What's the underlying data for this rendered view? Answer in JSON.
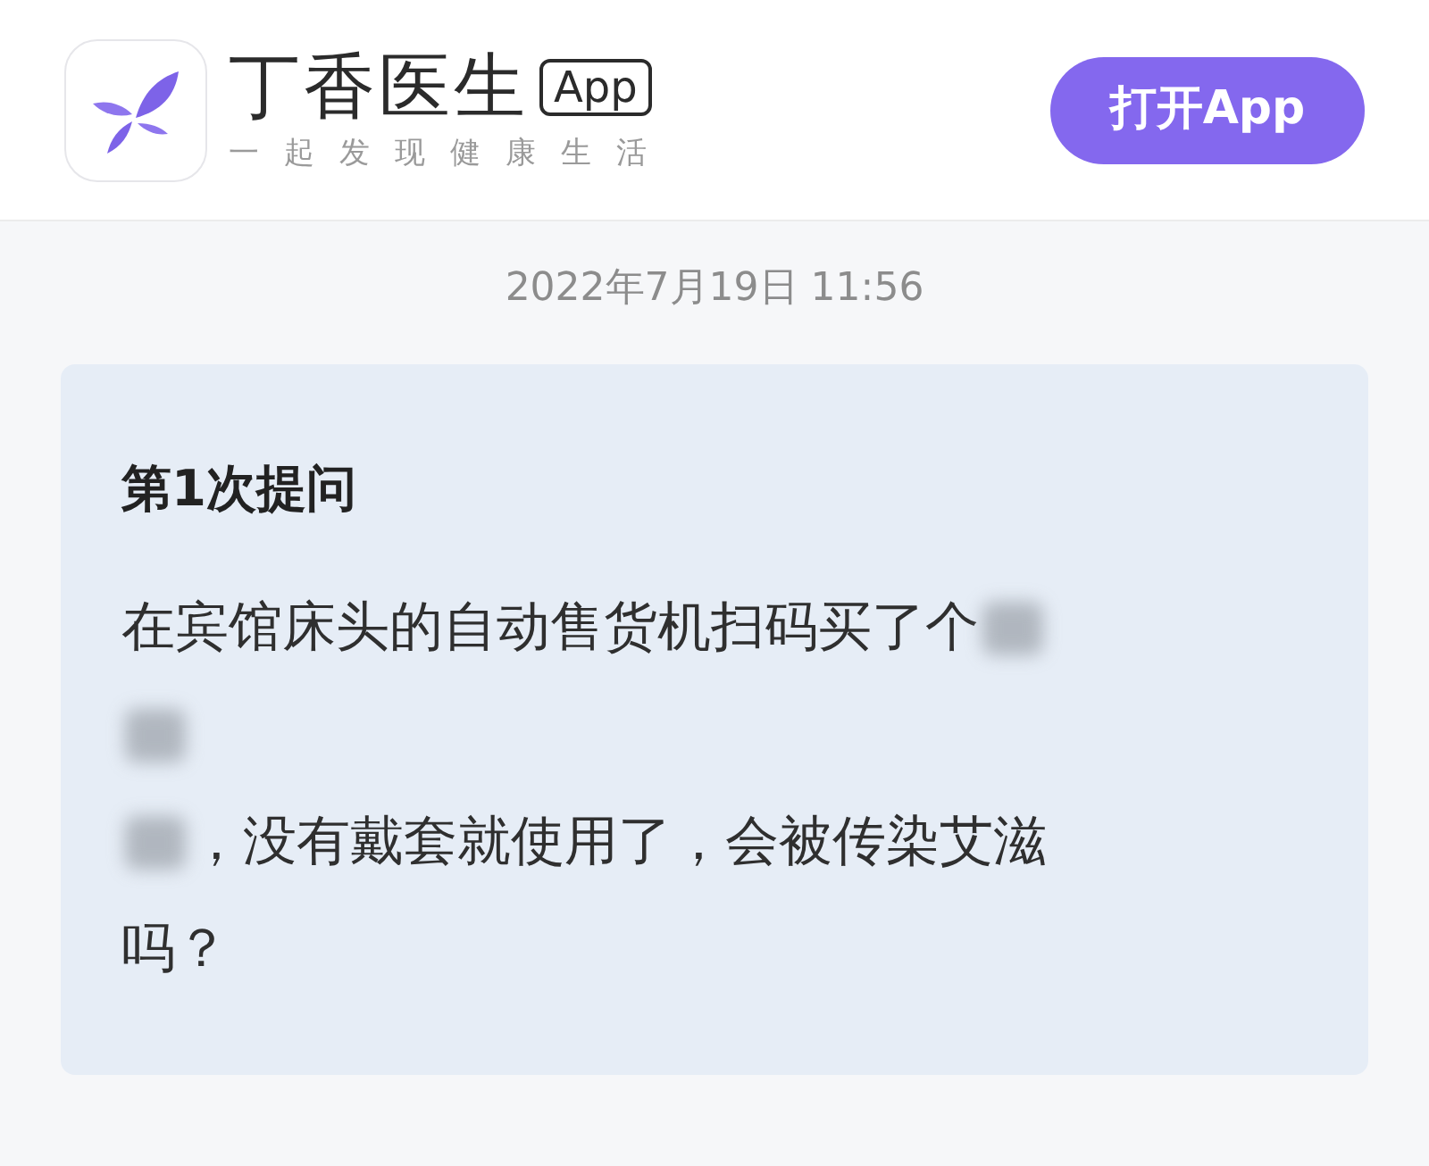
{
  "header": {
    "brand": "丁香医生",
    "brand_badge": "App",
    "tagline": "一起发现健康生活",
    "open_button": "打开App"
  },
  "timestamp": "2022年7月19日 11:56",
  "question": {
    "title": "第1次提问",
    "lines": [
      [
        {
          "kind": "text",
          "text": "在宾馆床头的自动售货机扫码买了个"
        },
        {
          "kind": "blurred"
        }
      ],
      [
        {
          "kind": "blurred"
        }
      ],
      [
        {
          "kind": "blurred"
        },
        {
          "kind": "text",
          "text": "，没有戴套就使用了，会被传染艾滋"
        }
      ],
      [
        {
          "kind": "text",
          "text": "吗？"
        }
      ]
    ]
  }
}
